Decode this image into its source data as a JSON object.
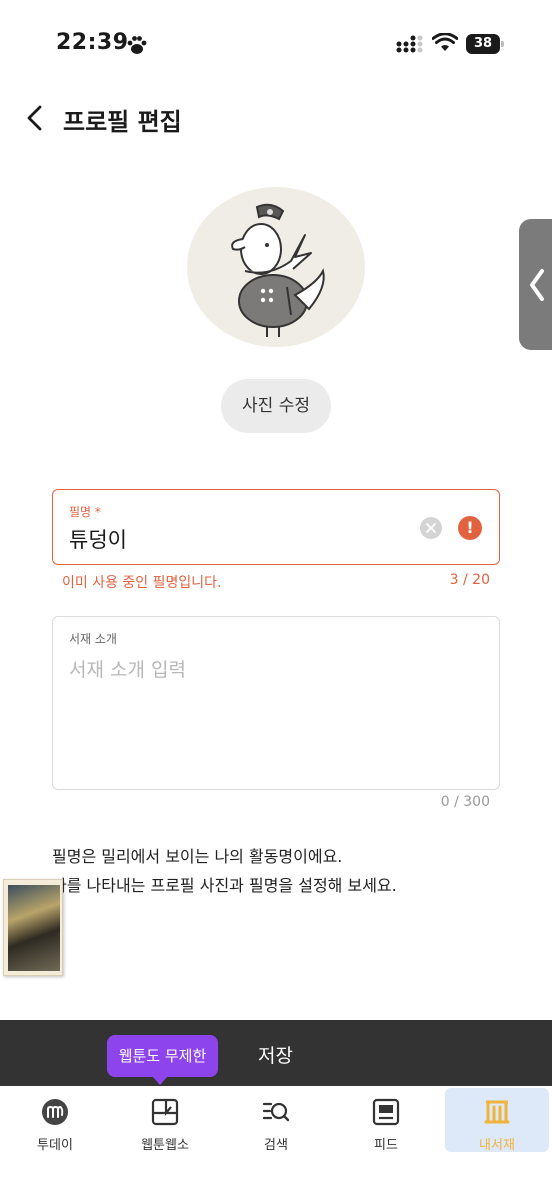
{
  "status": {
    "time": "22:39",
    "battery": "38"
  },
  "header": {
    "title": "프로필 편집"
  },
  "profile": {
    "photo_button": "사진 수정"
  },
  "nickname": {
    "label": "필명",
    "required_mark": "*",
    "value": "튜덩이",
    "error": "이미 사용 중인 필명입니다.",
    "count": "3 / 20"
  },
  "intro": {
    "label": "서재 소개",
    "placeholder": "서재 소개 입력",
    "count": "0 / 300"
  },
  "help": {
    "line1": "필명은 밀리에서 보이는 나의 활동명이에요.",
    "line2": "나를 나타내는 프로필 사진과 필명을 설정해 보세요."
  },
  "save_bar": {
    "label": "저장"
  },
  "tooltip": {
    "text": "웹툰도 무제한"
  },
  "tabs": [
    {
      "label": "투데이",
      "icon": "milli-logo-icon"
    },
    {
      "label": "웹툰웹소",
      "icon": "webtoon-icon"
    },
    {
      "label": "검색",
      "icon": "search-list-icon"
    },
    {
      "label": "피드",
      "icon": "feed-icon"
    },
    {
      "label": "내서재",
      "icon": "library-icon",
      "active": true
    }
  ],
  "colors": {
    "error": "#e2623f",
    "save_bar": "#333333",
    "tooltip": "#8e44ec",
    "active_tab_bg": "#dde9f8",
    "active_tab_text": "#f0b43a"
  }
}
